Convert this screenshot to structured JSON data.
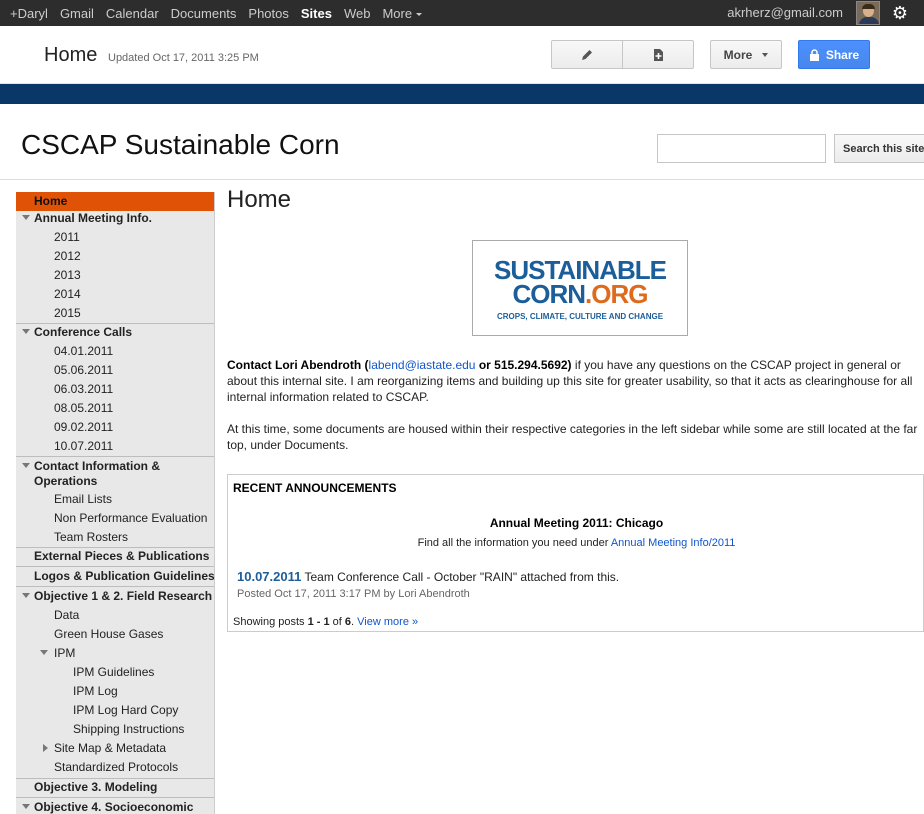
{
  "topbar": {
    "links": [
      "+Daryl",
      "Gmail",
      "Calendar",
      "Documents",
      "Photos",
      "Sites",
      "Web",
      "More"
    ],
    "active": "Sites",
    "email": "akrherz@gmail.com"
  },
  "header": {
    "title": "Home",
    "updated": "Updated Oct 17, 2011 3:25 PM",
    "more_label": "More",
    "share_label": "Share"
  },
  "site": {
    "title": "CSCAP Sustainable Corn",
    "search_button": "Search this site"
  },
  "sidebar": [
    {
      "label": "Home",
      "selected": true
    },
    {
      "label": "Annual Meeting Info."
    },
    {
      "label": "2011"
    },
    {
      "label": "2012"
    },
    {
      "label": "2013"
    },
    {
      "label": "2014"
    },
    {
      "label": "2015"
    },
    {
      "label": "Conference Calls"
    },
    {
      "label": "04.01.2011"
    },
    {
      "label": "05.06.2011"
    },
    {
      "label": "06.03.2011"
    },
    {
      "label": "08.05.2011"
    },
    {
      "label": "09.02.2011"
    },
    {
      "label": "10.07.2011"
    },
    {
      "label": "Contact Information & Operations"
    },
    {
      "label": "Email Lists"
    },
    {
      "label": "Non Performance Evaluation"
    },
    {
      "label": "Team Rosters"
    },
    {
      "label": "External Pieces & Publications"
    },
    {
      "label": "Logos & Publication Guidelines"
    },
    {
      "label": "Objective 1 & 2. Field Research"
    },
    {
      "label": "Data"
    },
    {
      "label": "Green House Gases"
    },
    {
      "label": "IPM"
    },
    {
      "label": "IPM Guidelines"
    },
    {
      "label": "IPM Log"
    },
    {
      "label": "IPM Log Hard Copy"
    },
    {
      "label": "Shipping Instructions"
    },
    {
      "label": "Site Map & Metadata"
    },
    {
      "label": "Standardized Protocols"
    },
    {
      "label": "Objective 3. Modeling"
    },
    {
      "label": "Objective 4. Socioeconomic"
    }
  ],
  "main": {
    "heading": "Home",
    "logo": {
      "line1": "SUSTAINABLE",
      "line2a": "CORN",
      "line2b": ".ORG",
      "line3": "CROPS, CLIMATE, CULTURE AND CHANGE"
    },
    "contact": {
      "lead": "Contact Lori Abendroth (",
      "email": "labend@iastate.edu",
      "phone": " or 515.294.5692)",
      "rest": " if you have any questions on the CSCAP project in general or about this internal site. I am reorganizing items and building up this site for greater usability, so that it acts as clearinghouse for all internal information related to CSCAP."
    },
    "para2": "At this time, some documents are housed within their respective categories in the left sidebar while some are still located at the far top, under Documents.",
    "announcements": {
      "heading": "RECENT ANNOUNCEMENTS",
      "title": "Annual Meeting 2011: Chicago",
      "sub_text": "Find all the information you need under ",
      "sub_link": "Annual Meeting Info/2011",
      "post_date": "10.07.2011",
      "post_text": " Team Conference Call - October \"RAIN\" attached from this.",
      "post_meta": "Posted Oct 17, 2011 3:17 PM by Lori Abendroth",
      "showing_a": "Showing posts ",
      "showing_b": "1 - 1",
      "showing_c": " of ",
      "showing_d": "6",
      "showing_e": ". ",
      "view_more": "View more »"
    }
  }
}
